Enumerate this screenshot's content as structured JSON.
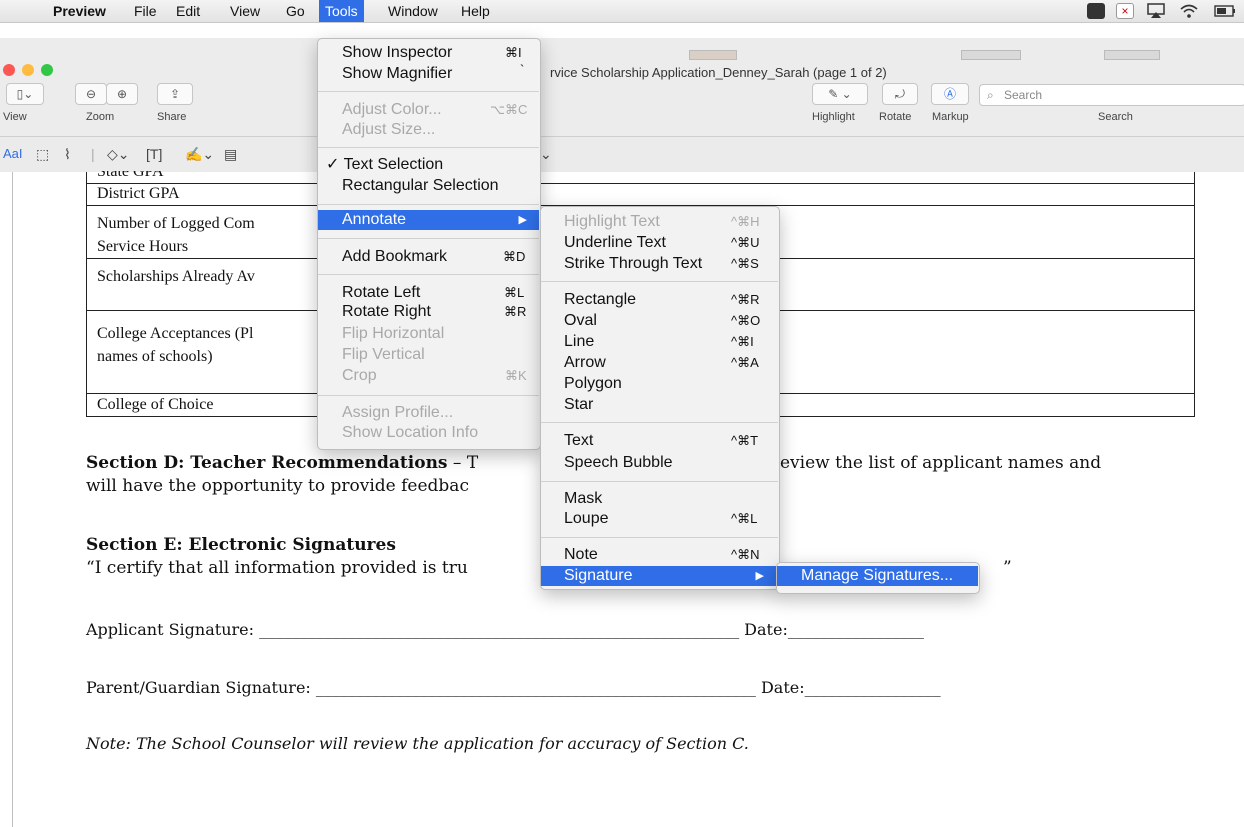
{
  "menubar": {
    "apple": "",
    "items": [
      "Preview",
      "File",
      "Edit",
      "View",
      "Go",
      "Tools",
      "Window",
      "Help"
    ]
  },
  "window": {
    "title": "rvice Scholarship Application_Denney_Sarah (page 1 of 2)",
    "toolbar": {
      "view_label": "View",
      "zoom_label": "Zoom",
      "share_label": "Share",
      "highlight_label": "Highlight",
      "rotate_label": "Rotate",
      "markup_label": "Markup",
      "search_label": "Search",
      "search_placeholder": "Search"
    },
    "markup_text_tool": "AaI"
  },
  "document": {
    "rows": [
      {
        "label": "State GPA"
      },
      {
        "label": "District GPA"
      },
      {
        "label": "Number of Logged Com"
      },
      {
        "label": "Service Hours"
      },
      {
        "label": "Scholarships Already Av"
      },
      {
        "label": "College Acceptances (Pl"
      },
      {
        "label": "names of schools)"
      },
      {
        "label": "College of Choice"
      }
    ],
    "section_d_bold": "Section D: Teacher Recommendations",
    "section_d_dash": " – T",
    "section_d_rest": "eview the list of applicant names and",
    "section_d_line2": "will have the opportunity to provide feedbac",
    "section_e_title": "Section E: Electronic Signatures",
    "section_e_text": "“I certify that all information provided is tru",
    "section_e_tail": "”",
    "applicant_sig": "Applicant Signature: ____________________________________________________________ Date:_________________",
    "parent_sig": "Parent/Guardian Signature: _______________________________________________________ Date:_________________",
    "note": "Note: The School Counselor will review the application for accuracy of Section C."
  },
  "tools_menu": {
    "items": [
      {
        "label": "Show Inspector",
        "shortcut": "⌘I"
      },
      {
        "label": "Show Magnifier",
        "shortcut": "`"
      },
      {
        "label": "Adjust Color...",
        "shortcut": "⌥⌘C"
      },
      {
        "label": "Adjust Size..."
      },
      {
        "label": "✓ Text Selection"
      },
      {
        "label": "Rectangular Selection"
      },
      {
        "label": "Annotate",
        "shortcut": "▶"
      },
      {
        "label": "Add Bookmark",
        "shortcut": "⌘D"
      },
      {
        "label": "Rotate Left",
        "shortcut": "⌘L"
      },
      {
        "label": "Rotate Right",
        "shortcut": "⌘R"
      },
      {
        "label": "Flip Horizontal"
      },
      {
        "label": "Flip Vertical"
      },
      {
        "label": "Crop",
        "shortcut": "⌘K"
      },
      {
        "label": "Assign Profile..."
      },
      {
        "label": "Show Location Info"
      }
    ]
  },
  "annotate_menu": {
    "items": [
      {
        "label": "Highlight Text",
        "shortcut": "^⌘H"
      },
      {
        "label": "Underline Text",
        "shortcut": "^⌘U"
      },
      {
        "label": "Strike Through Text",
        "shortcut": "^⌘S"
      },
      {
        "label": "Rectangle",
        "shortcut": "^⌘R"
      },
      {
        "label": "Oval",
        "shortcut": "^⌘O"
      },
      {
        "label": "Line",
        "shortcut": "^⌘I"
      },
      {
        "label": "Arrow",
        "shortcut": "^⌘A"
      },
      {
        "label": "Polygon"
      },
      {
        "label": "Star"
      },
      {
        "label": "Text",
        "shortcut": "^⌘T"
      },
      {
        "label": "Speech Bubble"
      },
      {
        "label": "Mask"
      },
      {
        "label": "Loupe",
        "shortcut": "^⌘L"
      },
      {
        "label": "Note",
        "shortcut": "^⌘N"
      },
      {
        "label": "Signature",
        "shortcut": "▶"
      }
    ]
  },
  "signature_menu": {
    "items": [
      {
        "label": "Manage Signatures..."
      }
    ]
  },
  "colors": {
    "accent": "#2f6ee6"
  }
}
